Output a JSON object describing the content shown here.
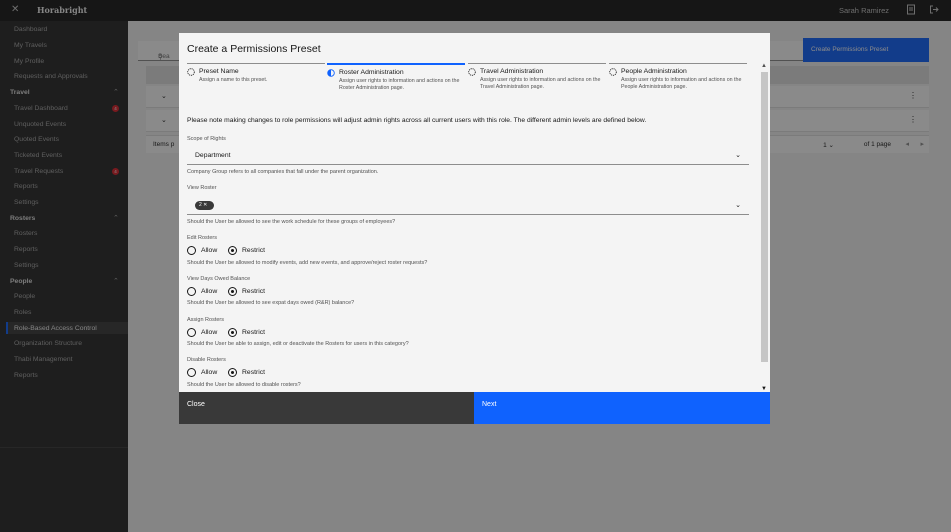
{
  "header": {
    "brand": "Horabright",
    "user_name": "Sarah Ramirez"
  },
  "sidebar": {
    "top_items": [
      "Dashboard",
      "My Travels",
      "My Profile",
      "Requests and Approvals"
    ],
    "travel": {
      "heading": "Travel",
      "items": [
        "Travel Dashboard",
        "Unquoted Events",
        "Quoted Events",
        "Ticketed Events",
        "Travel Requests",
        "Reports",
        "Settings"
      ],
      "badge_dashboard": "4",
      "badge_requests": "4"
    },
    "rosters": {
      "heading": "Rosters",
      "items": [
        "Rosters",
        "Reports",
        "Settings"
      ]
    },
    "people": {
      "heading": "People",
      "items": [
        "People",
        "Roles",
        "Role-Based Access Control",
        "Organization Structure",
        "Thabi Management",
        "Reports"
      ],
      "active": "Role-Based Access Control"
    }
  },
  "background": {
    "search_placeholder": "Sea",
    "create_button": "Create Permissions Preset",
    "items_per_page_label": "Items p",
    "page_value": "1",
    "page_of": "of 1 page"
  },
  "modal": {
    "title": "Create a Permissions Preset",
    "steps": [
      {
        "title": "Preset Name",
        "desc": "Assign a name to this preset."
      },
      {
        "title": "Roster Administration",
        "desc": "Assign user rights to information and actions on the Roster Administration page."
      },
      {
        "title": "Travel Administration",
        "desc": "Assign user rights to information and actions on the Travel Administration page."
      },
      {
        "title": "People Administration",
        "desc": "Assign user rights to information and actions on the People Administration page."
      }
    ],
    "note": "Please note making changes to role permissions will adjust admin rights across all current users with this role. The different admin levels are defined below.",
    "scope": {
      "label": "Scope of Rights",
      "value": "Department",
      "helper": "Company Group refers to all companies that fall under the parent organization."
    },
    "view_roster": {
      "label": "View Roster",
      "tag": "2",
      "helper": "Should the User be allowed to see the work schedule for these groups of employees?"
    },
    "edit_rosters": {
      "label": "Edit Rosters",
      "helper": "Should the User be allowed to modify events, add new events, and approve/reject roster requests?"
    },
    "view_days_owed": {
      "label": "View Days Owed Balance",
      "helper": "Should the User be allowed to see expat days owed (R&R) balance?"
    },
    "assign_rosters": {
      "label": "Assign Rosters",
      "helper": "Should the User be able to assign, edit or deactivate the Rosters for users in this category?"
    },
    "disable_rosters": {
      "label": "Disable Rosters",
      "helper": "Should the User be allowed to disable rosters?"
    },
    "allow_label": "Allow",
    "restrict_label": "Restrict",
    "close_label": "Close",
    "next_label": "Next"
  },
  "colors": {
    "accent": "#0f62fe",
    "sidebar_bg": "#262626",
    "header_bg": "#161616",
    "badge": "#da1e28"
  }
}
